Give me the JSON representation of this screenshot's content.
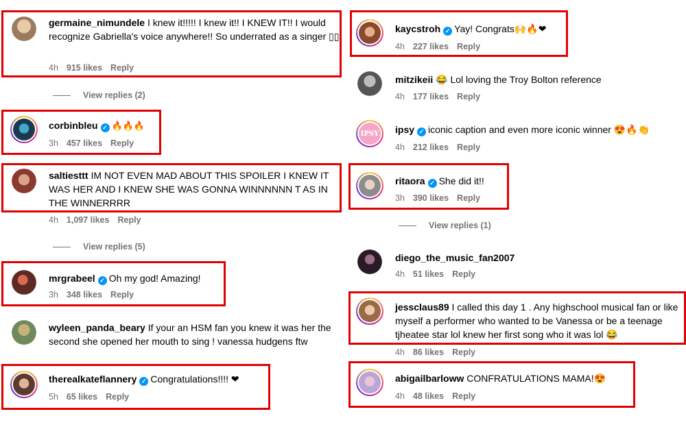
{
  "view_replies_left_1": "View replies (2)",
  "view_replies_left_2": "View replies (5)",
  "view_replies_right_1": "View replies (1)",
  "comments": {
    "germaine": {
      "username": "germaine_nimundele",
      "text": "I knew it!!!!! I knew it!! I KNEW IT!! I would recognize Gabriella's voice anywhere!! So underrated as a singer ▯▯",
      "time": "4h",
      "likes": "915 likes",
      "reply": "Reply"
    },
    "corbin": {
      "username": "corbinbleu",
      "text": "🔥🔥🔥",
      "time": "3h",
      "likes": "457 likes",
      "reply": "Reply"
    },
    "salties": {
      "username": "saltiesttt",
      "text": "IM NOT EVEN MAD ABOUT THIS SPOILER I KNEW IT WAS HER AND I KNEW SHE WAS GONNA WINNNNNN T AS IN THE WINNERRRR",
      "time": "4h",
      "likes": "1,097 likes",
      "reply": "Reply"
    },
    "mrgrabeel": {
      "username": "mrgrabeel",
      "text": "Oh my god! Amazing!",
      "time": "3h",
      "likes": "348 likes",
      "reply": "Reply"
    },
    "wyleen": {
      "username": "wyleen_panda_beary",
      "text": "If your an HSM fan you knew it was her the second she opened her mouth to sing ! vanessa hudgens ftw",
      "time": "",
      "likes": "",
      "reply": ""
    },
    "kate": {
      "username": "therealkateflannery",
      "text": "Congratulations!!!! ❤",
      "time": "5h",
      "likes": "65 likes",
      "reply": "Reply"
    },
    "kaycstroh": {
      "username": "kaycstroh",
      "text": "Yay! Congrats🙌🔥❤",
      "time": "4h",
      "likes": "227 likes",
      "reply": "Reply"
    },
    "mitzikeii": {
      "username": "mitzikeii",
      "text": "😂 Lol loving the Troy Bolton reference",
      "time": "4h",
      "likes": "177 likes",
      "reply": "Reply"
    },
    "ipsy": {
      "username": "ipsy",
      "text": "iconic caption and even more iconic winner 😍🔥👏",
      "time": "4h",
      "likes": "212 likes",
      "reply": "Reply",
      "avatar_label": "IPSY"
    },
    "ritaora": {
      "username": "ritaora",
      "text": "She did it!!",
      "time": "3h",
      "likes": "390 likes",
      "reply": "Reply"
    },
    "diego": {
      "username": "diego_the_music_fan2007",
      "text": "",
      "time": "4h",
      "likes": "51 likes",
      "reply": "Reply"
    },
    "jessclaus": {
      "username": "jessclaus89",
      "text": "I called this day 1 . Any highschool musical fan or like myself a performer who wanted to be Vanessa or be a teenage tjheatee star lol knew her first song who it was lol 😂",
      "time": "4h",
      "likes": "86 likes",
      "reply": "Reply"
    },
    "abigail": {
      "username": "abigailbarloww",
      "text": "CONFRATULATIONS MAMA!😍",
      "time": "4h",
      "likes": "48 likes",
      "reply": "Reply"
    }
  },
  "colors": {
    "highlight": "#e00000",
    "verified": "#0095f6",
    "meta": "#737373"
  }
}
